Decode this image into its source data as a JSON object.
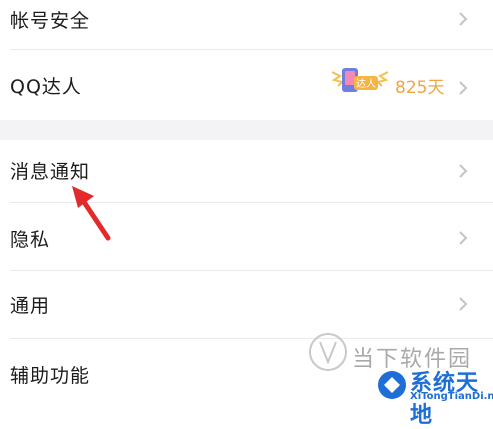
{
  "settings": {
    "items": [
      {
        "label": "帐号安全"
      },
      {
        "label": "QQ达人",
        "badge_text": "达人",
        "days": "825天"
      },
      {
        "label": "消息通知"
      },
      {
        "label": "隐私"
      },
      {
        "label": "通用"
      },
      {
        "label": "辅助功能"
      }
    ]
  },
  "watermark": {
    "site_cn": "当下软件园",
    "brand": "系统天地",
    "url": "XiTongTianDi.net"
  },
  "colors": {
    "accent_orange": "#f0a63c",
    "arrow_red": "#e32b2b",
    "brand_blue": "#1e6ed8"
  }
}
